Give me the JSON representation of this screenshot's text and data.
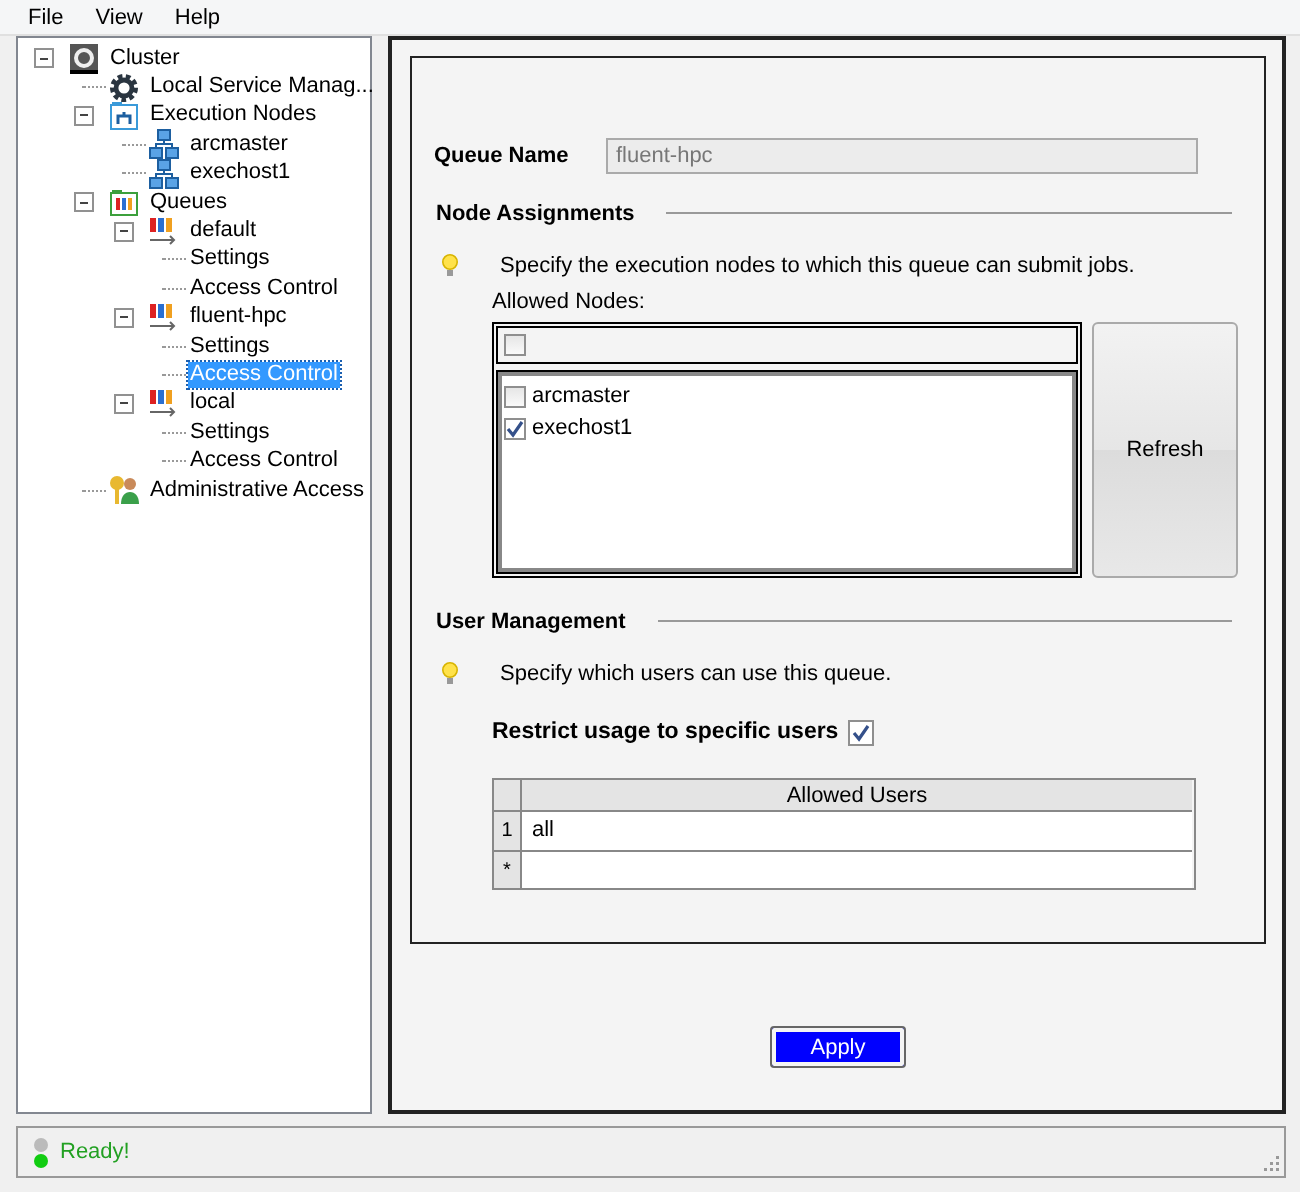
{
  "menu": [
    {
      "label": "File"
    },
    {
      "label": "View"
    },
    {
      "label": "Help"
    }
  ],
  "tree": [
    {
      "label": "Cluster",
      "kind": "cluster",
      "expanded": true,
      "selected": false,
      "children": [
        {
          "label": "Local Service Manag...",
          "kind": "service",
          "selected": false
        },
        {
          "label": "Execution Nodes",
          "kind": "hosts",
          "expanded": true,
          "selected": false,
          "children": [
            {
              "label": "arcmaster",
              "kind": "host",
              "selected": false
            },
            {
              "label": "exechost1",
              "kind": "host",
              "selected": false
            }
          ]
        },
        {
          "label": "Queues",
          "kind": "queues",
          "expanded": true,
          "selected": false,
          "children": [
            {
              "label": "default",
              "kind": "queue",
              "expanded": true,
              "selected": false,
              "children": [
                {
                  "label": "Settings",
                  "selected": false
                },
                {
                  "label": "Access Control",
                  "selected": false
                }
              ]
            },
            {
              "label": "fluent-hpc",
              "kind": "queue",
              "expanded": true,
              "selected": false,
              "children": [
                {
                  "label": "Settings",
                  "selected": false
                },
                {
                  "label": "Access Control",
                  "selected": true
                }
              ]
            },
            {
              "label": "local",
              "kind": "queue",
              "expanded": true,
              "selected": false,
              "children": [
                {
                  "label": "Settings",
                  "selected": false
                },
                {
                  "label": "Access Control",
                  "selected": false
                }
              ]
            }
          ]
        },
        {
          "label": "Administrative Access",
          "kind": "admin",
          "selected": false
        }
      ]
    }
  ],
  "form": {
    "queue_name": {
      "label": "Queue Name",
      "value": "fluent-hpc",
      "disabled": true
    },
    "node_assignments": {
      "heading": "Node Assignments",
      "hint": "Specify the execution nodes to which this queue can submit jobs.",
      "allowed_nodes_label": "Allowed Nodes:",
      "select_all": {
        "checked": false
      },
      "nodes": [
        {
          "label": "arcmaster",
          "checked": false
        },
        {
          "label": "exechost1",
          "checked": true
        }
      ],
      "refresh_button": "Refresh"
    },
    "user_management": {
      "heading": "User Management",
      "hint": "Specify which users can use this queue.",
      "restrict": {
        "label": "Restrict usage to specific users",
        "checked": true
      },
      "table": {
        "columns": [
          "Allowed Users"
        ],
        "rows": [
          {
            "header": "1",
            "cells": [
              "all"
            ]
          },
          {
            "header": "*"
          }
        ]
      }
    }
  },
  "apply_button": "Apply",
  "status_bar": {
    "text": "Ready!"
  }
}
